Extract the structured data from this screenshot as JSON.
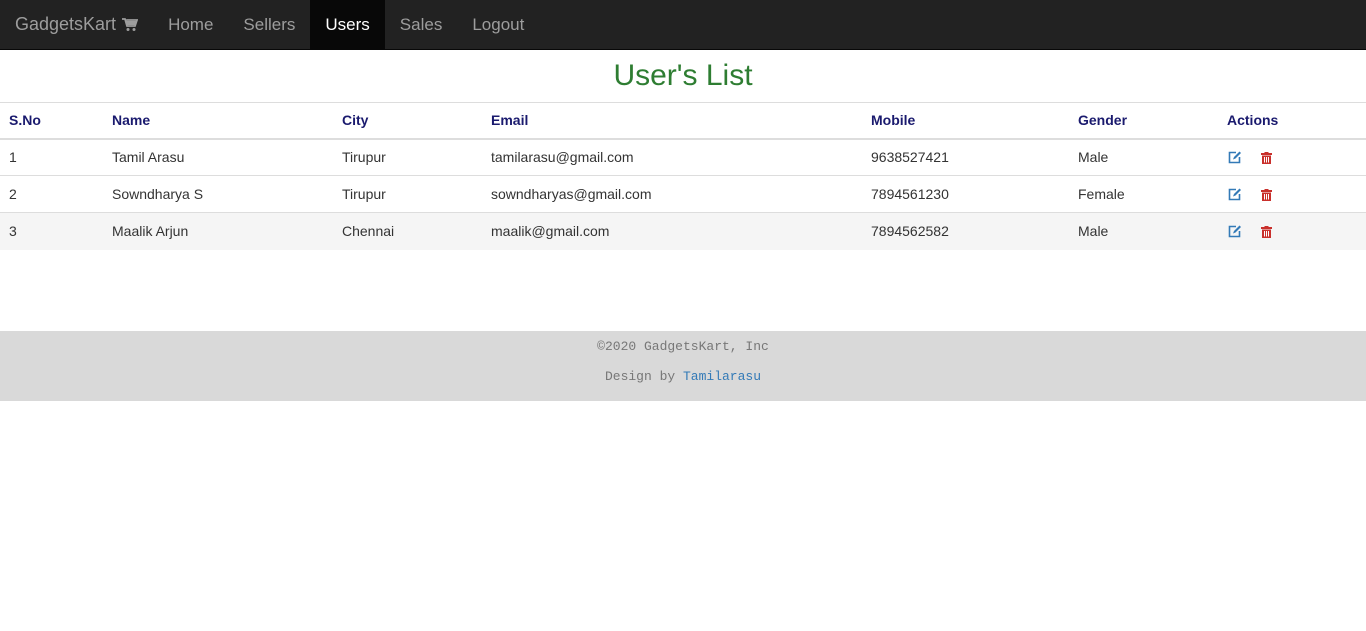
{
  "nav": {
    "brand": "GadgetsKart",
    "items": [
      {
        "label": "Home"
      },
      {
        "label": "Sellers"
      },
      {
        "label": "Users",
        "active": true
      },
      {
        "label": "Sales"
      },
      {
        "label": "Logout"
      }
    ]
  },
  "page": {
    "title": "User's List"
  },
  "table": {
    "headers": [
      "S.No",
      "Name",
      "City",
      "Email",
      "Mobile",
      "Gender",
      "Actions"
    ],
    "rows": [
      {
        "sno": "1",
        "name": "Tamil Arasu",
        "city": "Tirupur",
        "email": "tamilarasu@gmail.com",
        "mobile": "9638527421",
        "gender": "Male"
      },
      {
        "sno": "2",
        "name": "Sowndharya S",
        "city": "Tirupur",
        "email": "sowndharyas@gmail.com",
        "mobile": "7894561230",
        "gender": "Female"
      },
      {
        "sno": "3",
        "name": "Maalik Arjun",
        "city": "Chennai",
        "email": "maalik@gmail.com",
        "mobile": "7894562582",
        "gender": "Male"
      }
    ]
  },
  "footer": {
    "copyright": "©2020 GadgetsKart, Inc",
    "design_prefix": "Design by",
    "designer": "Tamilarasu"
  },
  "colors": {
    "navbar_bg": "#222222",
    "title": "#2e7d32",
    "header_text": "#1a1a6e",
    "edit_icon": "#337ab7",
    "delete_icon": "#c9302c",
    "footer_bg": "#d9d9d9"
  },
  "icons": {
    "brand": "shopping-cart-icon",
    "edit": "edit-icon",
    "delete": "trash-icon"
  }
}
